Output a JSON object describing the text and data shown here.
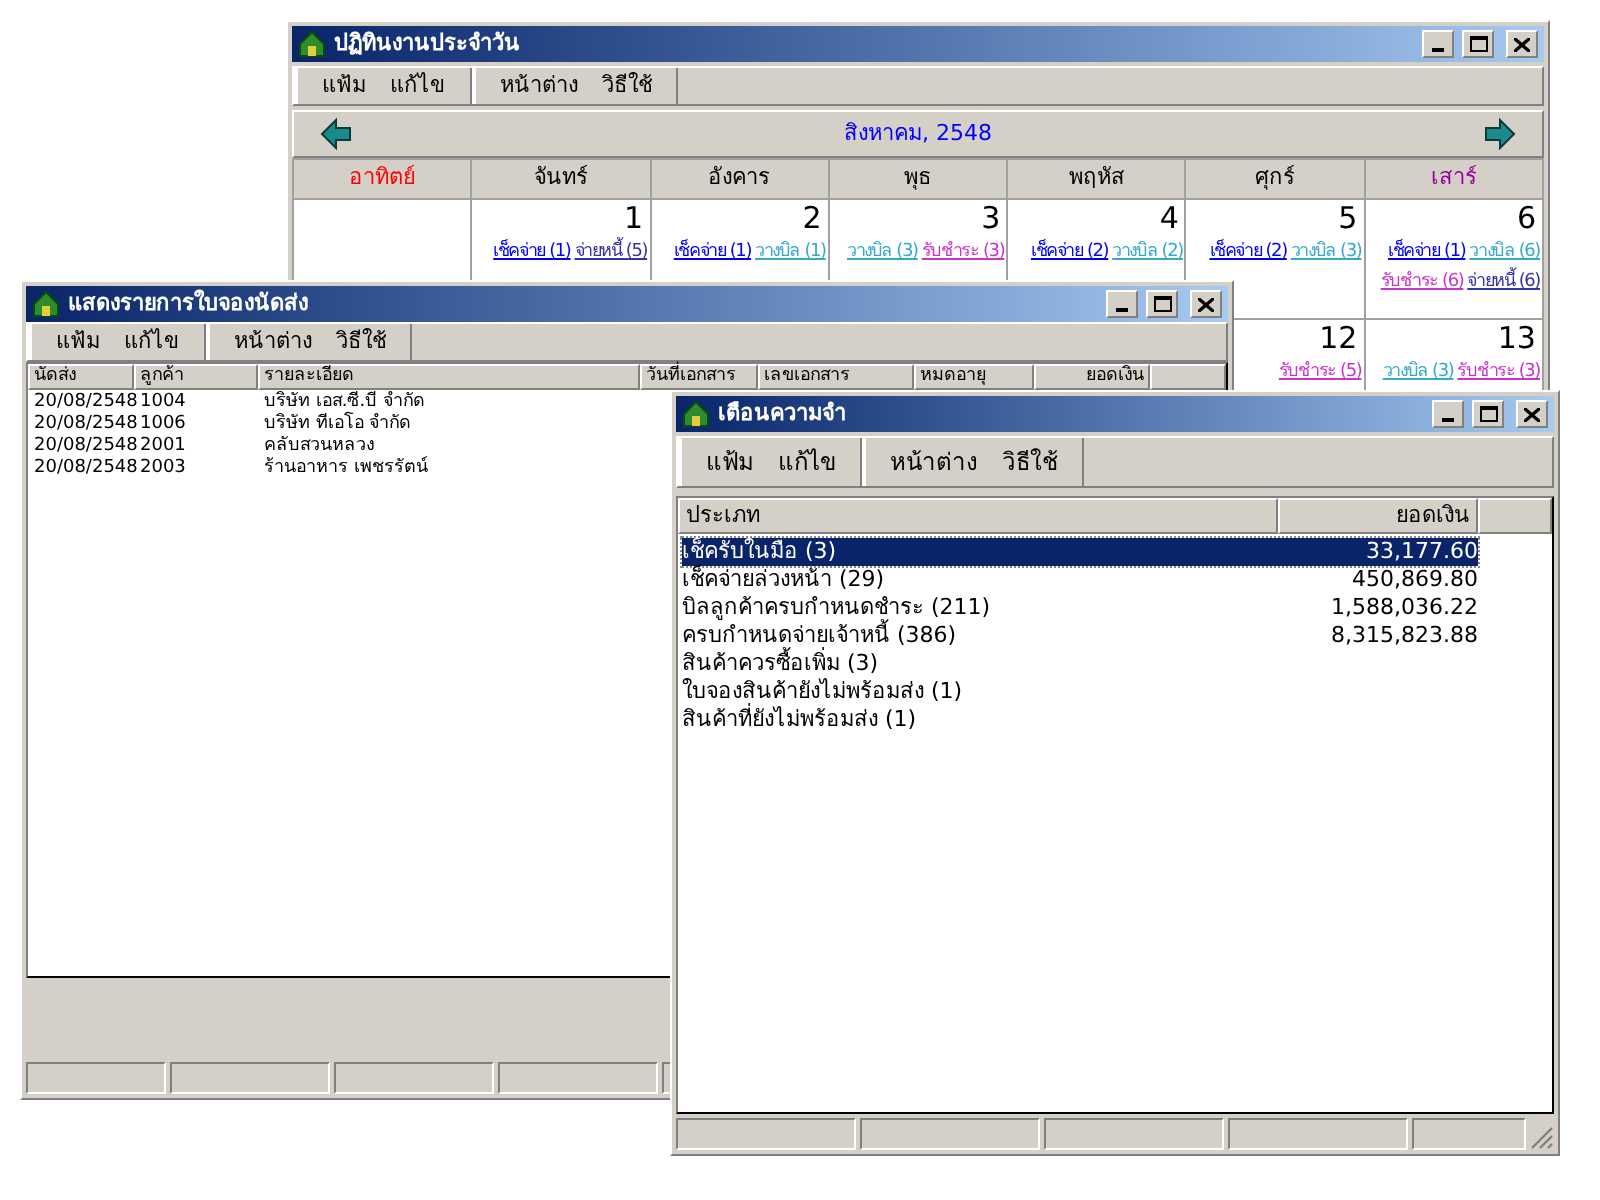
{
  "calendar_window": {
    "title": "ปฏิทินงานประจำวัน",
    "menu_groups": [
      [
        "แฟ้ม",
        "แก้ไข"
      ],
      [
        "หน้าต่าง",
        "วิธีใช้"
      ]
    ],
    "month": "สิงหาคม, 2548",
    "weekdays": [
      {
        "label": "อาทิตย์",
        "color": "#ff0000"
      },
      {
        "label": "จันทร์",
        "color": "#000000"
      },
      {
        "label": "อังคาร",
        "color": "#000000"
      },
      {
        "label": "พุธ",
        "color": "#000000"
      },
      {
        "label": "พฤหัส",
        "color": "#000000"
      },
      {
        "label": "ศุกร์",
        "color": "#000000"
      },
      {
        "label": "เสาร์",
        "color": "#990099"
      }
    ],
    "weeks": [
      {
        "mon": {
          "day": "1",
          "entries": [
            {
              "label": "เช็คจ่าย (1)",
              "color": "#0000ff"
            },
            {
              "label": "จ่ายหนี้ (5)",
              "color": "#3333aa"
            }
          ]
        },
        "tue": {
          "day": "2",
          "entries": [
            {
              "label": "เช็คจ่าย (1)",
              "color": "#0000ff"
            },
            {
              "label": "วางบิล (1)",
              "color": "#33aacc"
            }
          ]
        },
        "wed": {
          "day": "3",
          "entries": [
            {
              "label": "วางบิล (3)",
              "color": "#33aacc"
            },
            {
              "label": "รับชำระ (3)",
              "color": "#cc33cc"
            }
          ]
        },
        "thu": {
          "day": "4",
          "entries": [
            {
              "label": "เช็คจ่าย (2)",
              "color": "#0000ff"
            },
            {
              "label": "วางบิล (2)",
              "color": "#33aacc"
            }
          ]
        },
        "fri": {
          "day": "5",
          "entries": [
            {
              "label": "เช็คจ่าย (2)",
              "color": "#0000ff"
            },
            {
              "label": "วางบิล (3)",
              "color": "#33aacc"
            }
          ]
        },
        "sat": {
          "day": "6",
          "entries": [
            {
              "label": "เช็คจ่าย (1)",
              "color": "#0000ff"
            },
            {
              "label": "วางบิล (6)",
              "color": "#33aacc"
            },
            {
              "label": "รับชำระ (6)",
              "color": "#cc33cc"
            },
            {
              "label": "จ่ายหนี้ (6)",
              "color": "#3333aa"
            }
          ]
        }
      },
      {
        "fri": {
          "day": "12",
          "entries": [
            {
              "label": "รับชำระ (5)",
              "color": "#cc33cc"
            }
          ]
        },
        "sat": {
          "day": "13",
          "entries": [
            {
              "label": "วางบิล (3)",
              "color": "#33aacc"
            },
            {
              "label": "รับชำระ (3)",
              "color": "#cc33cc"
            }
          ]
        }
      }
    ]
  },
  "order_window": {
    "title": "แสดงรายการใบจองนัดส่ง",
    "menu_groups": [
      [
        "แฟ้ม",
        "แก้ไข"
      ],
      [
        "หน้าต่าง",
        "วิธีใช้"
      ]
    ],
    "columns": [
      "นัดส่ง",
      "ลูกค้า",
      "รายละเอียด",
      "วันที่เอกสาร",
      "เลขเอกสาร",
      "หมดอายุ",
      "ยอดเงิน"
    ],
    "rows": [
      [
        "20/08/2548",
        "1004",
        "บริษัท เอส.ซี.บี จำกัด"
      ],
      [
        "20/08/2548",
        "1006",
        "บริษัท ทีเอโอ จำกัด"
      ],
      [
        "20/08/2548",
        "2001",
        "คลับสวนหลวง"
      ],
      [
        "20/08/2548",
        "2003",
        "ร้านอาหาร เพชรรัตน์"
      ]
    ]
  },
  "reminder_window": {
    "title": "เตือนความจำ",
    "menu_groups": [
      [
        "แฟ้ม",
        "แก้ไข"
      ],
      [
        "หน้าต่าง",
        "วิธีใช้"
      ]
    ],
    "columns": [
      "ประเภท",
      "ยอดเงิน"
    ],
    "rows": [
      {
        "type": "เช็ครับในมือ (3)",
        "amount": "33,177.60",
        "selected": true
      },
      {
        "type": "เช็คจ่ายล่วงหน้า (29)",
        "amount": "450,869.80",
        "selected": false
      },
      {
        "type": "บิลลูกค้าครบกำหนดชำระ (211)",
        "amount": "1,588,036.22",
        "selected": false
      },
      {
        "type": "ครบกำหนดจ่ายเจ้าหนี้ (386)",
        "amount": "8,315,823.88",
        "selected": false
      },
      {
        "type": "สินค้าควรซื้อเพิ่ม (3)",
        "selected": false
      },
      {
        "type": "ใบจองสินค้ายังไม่พร้อมส่ง (1)",
        "selected": false
      },
      {
        "type": "สินค้าที่ยังไม่พร้อมส่ง (1)",
        "selected": false
      }
    ]
  }
}
